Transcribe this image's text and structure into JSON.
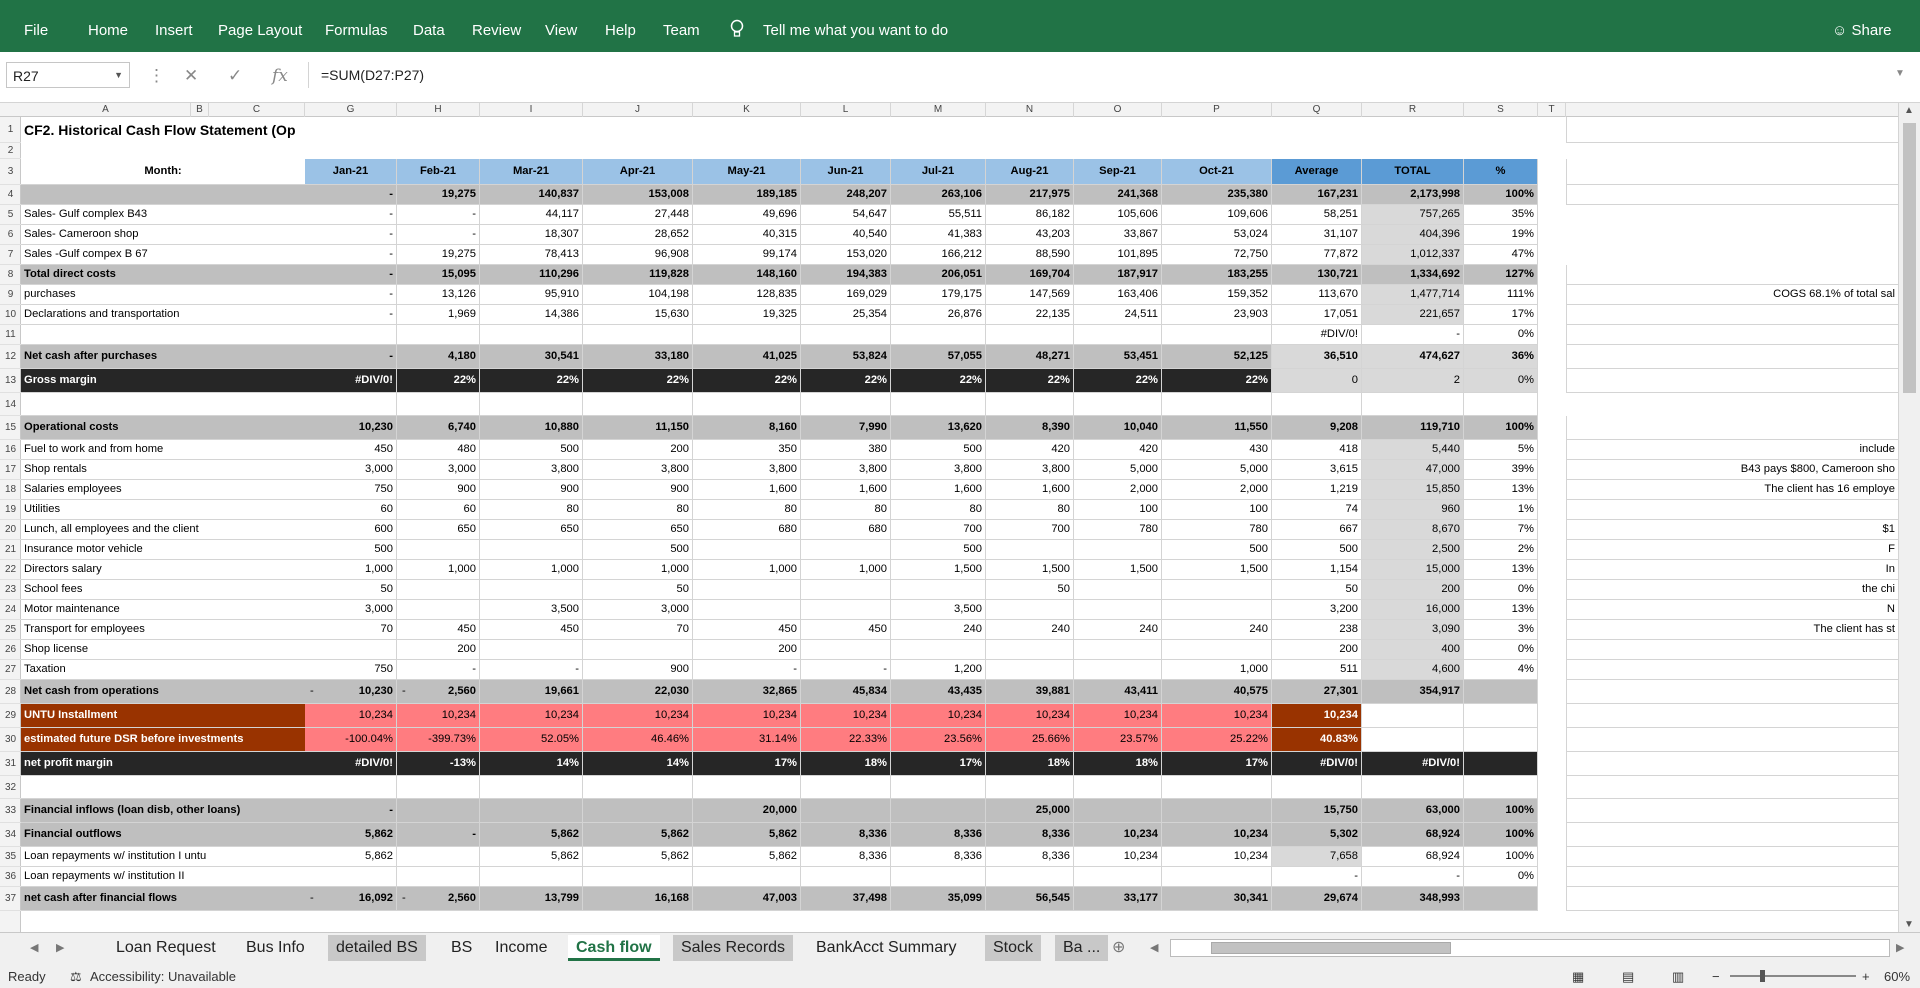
{
  "ribbon": {
    "tabs": [
      "File",
      "Home",
      "Insert",
      "Page Layout",
      "Formulas",
      "Data",
      "Review",
      "View",
      "Help",
      "Team"
    ],
    "tell_me": "Tell me what you want to do",
    "share": "Share"
  },
  "formula_bar": {
    "name_box": "R27",
    "formula": "=SUM(D27:P27)"
  },
  "columns": [
    "A",
    "B",
    "C",
    "G",
    "H",
    "I",
    "J",
    "K",
    "L",
    "M",
    "N",
    "O",
    "P",
    "Q",
    "R",
    "S",
    "T"
  ],
  "sheet": {
    "title": "CF2. Historical Cash Flow Statement (Op",
    "month_label": "Month:",
    "headers": [
      "Jan-21",
      "Feb-21",
      "Mar-21",
      "Apr-21",
      "May-21",
      "Jun-21",
      "Jul-21",
      "Aug-21",
      "Sep-21",
      "Oct-21",
      "Average",
      "TOTAL",
      "%"
    ],
    "rows": [
      {
        "num": "4",
        "label": "",
        "values": [
          "-",
          "19,275",
          "140,837",
          "153,008",
          "189,185",
          "248,207",
          "263,106",
          "217,975",
          "241,368",
          "235,380",
          "167,231",
          "2,173,998",
          "100%"
        ]
      },
      {
        "num": "5",
        "label": "Sales- Gulf complex  B43",
        "values": [
          "-",
          "-",
          "44,117",
          "27,448",
          "49,696",
          "54,647",
          "55,511",
          "86,182",
          "105,606",
          "109,606",
          "58,251",
          "757,265",
          "35%"
        ]
      },
      {
        "num": "6",
        "label": "Sales- Cameroon shop",
        "values": [
          "-",
          "-",
          "18,307",
          "28,652",
          "40,315",
          "40,540",
          "41,383",
          "43,203",
          "33,867",
          "53,024",
          "31,107",
          "404,396",
          "19%"
        ]
      },
      {
        "num": "7",
        "label": "Sales -Gulf compex B 67",
        "values": [
          "-",
          "19,275",
          "78,413",
          "96,908",
          "99,174",
          "153,020",
          "166,212",
          "88,590",
          "101,895",
          "72,750",
          "77,872",
          "1,012,337",
          "47%"
        ]
      },
      {
        "num": "8",
        "label": "Total direct costs",
        "values": [
          "-",
          "15,095",
          "110,296",
          "119,828",
          "148,160",
          "194,383",
          "206,051",
          "169,704",
          "187,917",
          "183,255",
          "130,721",
          "1,334,692",
          "127%"
        ]
      },
      {
        "num": "9",
        "label": "purchases",
        "values": [
          "-",
          "13,126",
          "95,910",
          "104,198",
          "128,835",
          "169,029",
          "179,175",
          "147,569",
          "163,406",
          "159,352",
          "113,670",
          "1,477,714",
          "111%"
        ]
      },
      {
        "num": "10",
        "label": "Declarations and transportation",
        "values": [
          "-",
          "1,969",
          "14,386",
          "15,630",
          "19,325",
          "25,354",
          "26,876",
          "22,135",
          "24,511",
          "23,903",
          "17,051",
          "221,657",
          "17%"
        ]
      },
      {
        "num": "11",
        "label": "",
        "values": [
          "",
          "",
          "",
          "",
          "",
          "",
          "",
          "",
          "",
          "",
          "#DIV/0!",
          "-",
          "0%"
        ]
      },
      {
        "num": "12",
        "label": "Net cash after purchases",
        "values": [
          "-",
          "4,180",
          "30,541",
          "33,180",
          "41,025",
          "53,824",
          "57,055",
          "48,271",
          "53,451",
          "52,125",
          "36,510",
          "474,627",
          "36%"
        ]
      },
      {
        "num": "13",
        "label": "Gross margin",
        "values": [
          "#DIV/0!",
          "22%",
          "22%",
          "22%",
          "22%",
          "22%",
          "22%",
          "22%",
          "22%",
          "22%",
          "0",
          "2",
          "0%"
        ]
      },
      {
        "num": "14",
        "label": "",
        "values": [
          "",
          "",
          "",
          "",
          "",
          "",
          "",
          "",
          "",
          "",
          "",
          "",
          ""
        ]
      },
      {
        "num": "15",
        "label": "Operational costs",
        "values": [
          "10,230",
          "6,740",
          "10,880",
          "11,150",
          "8,160",
          "7,990",
          "13,620",
          "8,390",
          "10,040",
          "11,550",
          "9,208",
          "119,710",
          "100%"
        ]
      },
      {
        "num": "16",
        "label": "Fuel to work and from home",
        "values": [
          "450",
          "480",
          "500",
          "200",
          "350",
          "380",
          "500",
          "420",
          "420",
          "430",
          "418",
          "5,440",
          "5%"
        ]
      },
      {
        "num": "17",
        "label": "Shop rentals",
        "values": [
          "3,000",
          "3,000",
          "3,800",
          "3,800",
          "3,800",
          "3,800",
          "3,800",
          "3,800",
          "5,000",
          "5,000",
          "3,615",
          "47,000",
          "39%"
        ]
      },
      {
        "num": "18",
        "label": "Salaries employees",
        "values": [
          "750",
          "900",
          "900",
          "900",
          "1,600",
          "1,600",
          "1,600",
          "1,600",
          "2,000",
          "2,000",
          "1,219",
          "15,850",
          "13%"
        ]
      },
      {
        "num": "19",
        "label": "Utilities",
        "values": [
          "60",
          "60",
          "80",
          "80",
          "80",
          "80",
          "80",
          "80",
          "100",
          "100",
          "74",
          "960",
          "1%"
        ]
      },
      {
        "num": "20",
        "label": "Lunch, all employees and the client",
        "values": [
          "600",
          "650",
          "650",
          "650",
          "680",
          "680",
          "700",
          "700",
          "780",
          "780",
          "667",
          "8,670",
          "7%"
        ]
      },
      {
        "num": "21",
        "label": "Insurance motor vehicle",
        "values": [
          "500",
          "",
          "",
          "500",
          "",
          "",
          "500",
          "",
          "",
          "500",
          "500",
          "2,500",
          "2%"
        ]
      },
      {
        "num": "22",
        "label": "Directors salary",
        "values": [
          "1,000",
          "1,000",
          "1,000",
          "1,000",
          "1,000",
          "1,000",
          "1,500",
          "1,500",
          "1,500",
          "1,500",
          "1,154",
          "15,000",
          "13%"
        ]
      },
      {
        "num": "23",
        "label": "School fees",
        "values": [
          "50",
          "",
          "",
          "50",
          "",
          "",
          "",
          "50",
          "",
          "",
          "50",
          "200",
          "0%"
        ]
      },
      {
        "num": "24",
        "label": "Motor maintenance",
        "values": [
          "3,000",
          "",
          "3,500",
          "3,000",
          "",
          "",
          "3,500",
          "",
          "",
          "",
          "3,200",
          "16,000",
          "13%"
        ]
      },
      {
        "num": "25",
        "label": "Transport  for employees",
        "values": [
          "70",
          "450",
          "450",
          "70",
          "450",
          "450",
          "240",
          "240",
          "240",
          "240",
          "238",
          "3,090",
          "3%"
        ]
      },
      {
        "num": "26",
        "label": "Shop license",
        "values": [
          "",
          "200",
          "",
          "",
          "200",
          "",
          "",
          "",
          "",
          "",
          "200",
          "400",
          "0%"
        ]
      },
      {
        "num": "27",
        "label": "Taxation",
        "values": [
          "750",
          "-",
          "-",
          "900",
          "-",
          "-",
          "1,200",
          "",
          "",
          "1,000",
          "511",
          "4,600",
          "4%"
        ]
      },
      {
        "num": "28",
        "label": "Net cash from operations",
        "values": [
          "10,230",
          "2,560",
          "19,661",
          "22,030",
          "32,865",
          "45,834",
          "43,435",
          "39,881",
          "43,411",
          "40,575",
          "27,301",
          "354,917",
          ""
        ]
      },
      {
        "num": "29",
        "label": "UNTU Installment",
        "values": [
          "10,234",
          "10,234",
          "10,234",
          "10,234",
          "10,234",
          "10,234",
          "10,234",
          "10,234",
          "10,234",
          "10,234",
          "10,234",
          "",
          ""
        ]
      },
      {
        "num": "30",
        "label": "estimated future DSR before investments",
        "values": [
          "-100.04%",
          "-399.73%",
          "52.05%",
          "46.46%",
          "31.14%",
          "22.33%",
          "23.56%",
          "25.66%",
          "23.57%",
          "25.22%",
          "40.83%",
          "",
          ""
        ]
      },
      {
        "num": "31",
        "label": "net profit margin",
        "values": [
          "#DIV/0!",
          "-13%",
          "14%",
          "14%",
          "17%",
          "18%",
          "17%",
          "18%",
          "18%",
          "17%",
          "#DIV/0!",
          "#DIV/0!",
          ""
        ]
      },
      {
        "num": "32",
        "label": "",
        "values": [
          "",
          "",
          "",
          "",
          "",
          "",
          "",
          "",
          "",
          "",
          "",
          "",
          ""
        ]
      },
      {
        "num": "33",
        "label": "Financial inflows (loan disb, other loans)",
        "values": [
          "-",
          "",
          "",
          "",
          "20,000",
          "",
          "",
          "25,000",
          "",
          "",
          "15,750",
          "63,000",
          "100%"
        ]
      },
      {
        "num": "34",
        "label": "Financial outflows",
        "values": [
          "5,862",
          "-",
          "5,862",
          "5,862",
          "5,862",
          "8,336",
          "8,336",
          "8,336",
          "10,234",
          "10,234",
          "5,302",
          "68,924",
          "100%"
        ]
      },
      {
        "num": "35",
        "label": "Loan repayments w/ institution I untu",
        "values": [
          "5,862",
          "",
          "5,862",
          "5,862",
          "5,862",
          "8,336",
          "8,336",
          "8,336",
          "10,234",
          "10,234",
          "7,658",
          "68,924",
          "100%"
        ]
      },
      {
        "num": "36",
        "label": "Loan repayments w/ institution II",
        "values": [
          "",
          "",
          "",
          "",
          "",
          "",
          "",
          "",
          "",
          "",
          "-",
          "-",
          "0%"
        ]
      },
      {
        "num": "37",
        "label": "net cash after financial flows",
        "values": [
          "16,092",
          "2,560",
          "13,799",
          "16,168",
          "47,003",
          "37,498",
          "35,099",
          "56,545",
          "33,177",
          "30,341",
          "29,674",
          "348,993",
          ""
        ]
      }
    ],
    "leading_dash_rows": {
      "28": [
        "-",
        "-"
      ],
      "37": [
        "-",
        "-"
      ]
    },
    "notes": {
      "9": "COGS 68.1% of total sal",
      "16": "include",
      "17": "B43 pays $800, Cameroon sho",
      "18": "The client has 16 employe",
      "20": "$1",
      "21": "F",
      "22": "In",
      "23": "the chi",
      "24": "N",
      "25": "The client has st"
    }
  },
  "sheet_tabs": [
    "Loan Request",
    "Bus Info",
    "detailed BS",
    "BS",
    "Income",
    "Cash flow",
    "Sales Records",
    "BankAcct Summary",
    "Stock",
    "Ba ..."
  ],
  "active_tab": "Cash flow",
  "status": {
    "ready": "Ready",
    "accessibility": "Accessibility: Unavailable",
    "zoom": "60%"
  }
}
